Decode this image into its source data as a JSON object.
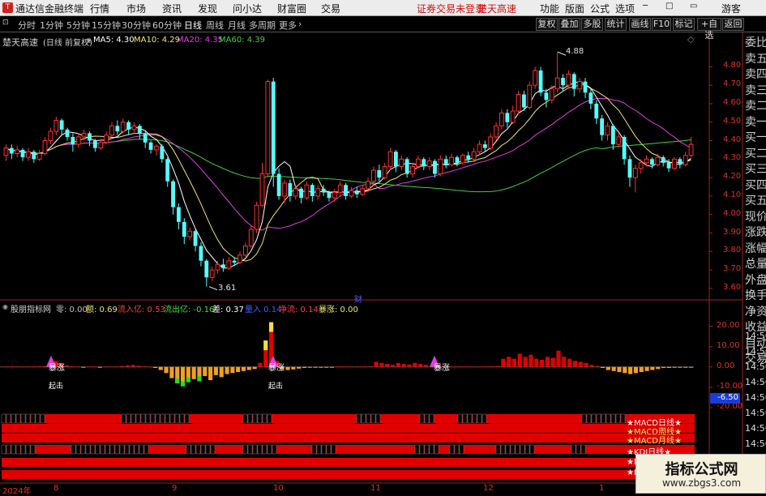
{
  "app": {
    "title": "通达信金融终端",
    "menu": [
      "行情",
      "市场",
      "资讯",
      "发现",
      "问小达",
      "财富圈",
      "交易"
    ],
    "notice1": "证券交易未登录",
    "notice2": "楚天高速",
    "right_menu": [
      "功能",
      "版面",
      "公式",
      "选项"
    ],
    "guest": "游客"
  },
  "toolbar": {
    "periods": [
      "分时",
      "1分钟",
      "5分钟",
      "15分钟",
      "30分钟",
      "60分钟",
      "日线",
      "周线",
      "月线",
      "多周期",
      "更多"
    ],
    "selected": "日线",
    "right_buttons": [
      "复权",
      "叠加",
      "多股",
      "统计",
      "画线",
      "F10",
      "标记",
      "+自选",
      "返回"
    ]
  },
  "main_panel": {
    "stock": "楚天高速",
    "mode": "(日线 前复权)",
    "ma": [
      {
        "label": "MA5: 4.30",
        "color": "#ffffff"
      },
      {
        "label": "MA10: 4.29",
        "color": "#f0e86c"
      },
      {
        "label": "MA20: 4.35",
        "color": "#e040e0"
      },
      {
        "label": "MA60: 4.39",
        "color": "#40d040"
      }
    ],
    "y_ticks": [
      "4.80",
      "4.70",
      "4.60",
      "4.50",
      "4.40",
      "4.30",
      "4.20",
      "4.10",
      "4.00",
      "3.90",
      "3.80",
      "3.70",
      "3.60"
    ],
    "high_label": "4.88",
    "low_label": "3.61",
    "cai_label": "财"
  },
  "indicator_panel": {
    "name": "股朋指标网",
    "values": [
      {
        "label": "零: 0.00",
        "color": "#c0c0c0"
      },
      {
        "label": "额: 0.69",
        "color": "#f0e86c"
      },
      {
        "label": "流入亿: 0.53",
        "color": "#ff4040"
      },
      {
        "label": "流出亿: -0.16",
        "color": "#40e040"
      },
      {
        "label": "差: 0.37",
        "color": "#ffffff"
      },
      {
        "label": "量入 0.14",
        "color": "#4060ff"
      },
      {
        "label": "净流: 0.14",
        "color": "#ff4040"
      },
      {
        "label": "暴涨: 0.00",
        "color": "#f0e86c"
      }
    ],
    "y_ticks": [
      "20.00",
      "10.00",
      "0.00",
      "-10.00",
      "-20.00"
    ],
    "current_value": "-6.50",
    "signal_baozhang": "暴涨",
    "signal_jichu": "起击",
    "band_labels": [
      "★MACD日线★",
      "★MACD周线★",
      "★MACD月线★",
      "★KDJ日线★",
      "★K"
    ]
  },
  "right_panel": {
    "items": [
      "委比",
      "卖五",
      "卖四",
      "卖三",
      "卖二",
      "卖一",
      "买一",
      "买二",
      "买三",
      "买四",
      "买五",
      "现价",
      "涨跌",
      "涨幅",
      "总量",
      "外盘",
      "换手",
      "净资",
      "收益",
      "自动",
      "交易"
    ],
    "times": [
      "14:56",
      "14:56",
      "14:56",
      "14:56",
      "14:56",
      "14:56",
      "14:56",
      "14:56",
      "14:56"
    ]
  },
  "x_axis": {
    "labels": [
      "2024年",
      "8",
      "9",
      "10",
      "11",
      "12",
      "1"
    ]
  },
  "watermark": {
    "title": "指标公式网",
    "url": "www.zbgs3.com"
  },
  "colors": {
    "up": "#ff3030",
    "down": "#54ffff",
    "ma5": "#ffffff",
    "ma10": "#f0e86c",
    "ma20": "#e040e0",
    "ma60": "#40d040",
    "bar_red": "#e00000",
    "bar_orange": "#f0a020",
    "bar_green": "#20e020",
    "band_red": "#e00000"
  },
  "chart_data": {
    "type": "candlestick",
    "price_range": [
      3.56,
      4.92
    ],
    "candles": [
      {
        "o": 4.32,
        "c": 4.36,
        "h": 4.38,
        "l": 4.29
      },
      {
        "o": 4.36,
        "c": 4.33,
        "h": 4.38,
        "l": 4.3
      },
      {
        "o": 4.33,
        "c": 4.35,
        "h": 4.37,
        "l": 4.31
      },
      {
        "o": 4.35,
        "c": 4.31,
        "h": 4.36,
        "l": 4.29
      },
      {
        "o": 4.31,
        "c": 4.34,
        "h": 4.36,
        "l": 4.29
      },
      {
        "o": 4.34,
        "c": 4.3,
        "h": 4.35,
        "l": 4.28
      },
      {
        "o": 4.3,
        "c": 4.33,
        "h": 4.35,
        "l": 4.29
      },
      {
        "o": 4.33,
        "c": 4.4,
        "h": 4.42,
        "l": 4.32
      },
      {
        "o": 4.4,
        "c": 4.45,
        "h": 4.47,
        "l": 4.38
      },
      {
        "o": 4.45,
        "c": 4.51,
        "h": 4.53,
        "l": 4.43
      },
      {
        "o": 4.51,
        "c": 4.46,
        "h": 4.52,
        "l": 4.43
      },
      {
        "o": 4.46,
        "c": 4.42,
        "h": 4.47,
        "l": 4.4
      },
      {
        "o": 4.42,
        "c": 4.38,
        "h": 4.44,
        "l": 4.34
      },
      {
        "o": 4.38,
        "c": 4.42,
        "h": 4.44,
        "l": 4.36
      },
      {
        "o": 4.42,
        "c": 4.44,
        "h": 4.46,
        "l": 4.4
      },
      {
        "o": 4.44,
        "c": 4.4,
        "h": 4.45,
        "l": 4.37
      },
      {
        "o": 4.4,
        "c": 4.36,
        "h": 4.41,
        "l": 4.34
      },
      {
        "o": 4.36,
        "c": 4.39,
        "h": 4.41,
        "l": 4.35
      },
      {
        "o": 4.39,
        "c": 4.43,
        "h": 4.45,
        "l": 4.38
      },
      {
        "o": 4.43,
        "c": 4.48,
        "h": 4.5,
        "l": 4.42
      },
      {
        "o": 4.48,
        "c": 4.45,
        "h": 4.51,
        "l": 4.43
      },
      {
        "o": 4.45,
        "c": 4.5,
        "h": 4.52,
        "l": 4.44
      },
      {
        "o": 4.5,
        "c": 4.46,
        "h": 4.51,
        "l": 4.43
      },
      {
        "o": 4.46,
        "c": 4.48,
        "h": 4.5,
        "l": 4.44
      },
      {
        "o": 4.48,
        "c": 4.44,
        "h": 4.49,
        "l": 4.41
      },
      {
        "o": 4.44,
        "c": 4.39,
        "h": 4.45,
        "l": 4.36
      },
      {
        "o": 4.39,
        "c": 4.35,
        "h": 4.4,
        "l": 4.33
      },
      {
        "o": 4.35,
        "c": 4.37,
        "h": 4.38,
        "l": 4.32
      },
      {
        "o": 4.37,
        "c": 4.3,
        "h": 4.38,
        "l": 4.28
      },
      {
        "o": 4.3,
        "c": 4.18,
        "h": 4.31,
        "l": 4.15
      },
      {
        "o": 4.18,
        "c": 4.04,
        "h": 4.19,
        "l": 4.0
      },
      {
        "o": 4.04,
        "c": 3.96,
        "h": 4.06,
        "l": 3.92
      },
      {
        "o": 3.96,
        "c": 3.88,
        "h": 3.98,
        "l": 3.84
      },
      {
        "o": 3.88,
        "c": 3.91,
        "h": 3.93,
        "l": 3.86
      },
      {
        "o": 3.91,
        "c": 3.83,
        "h": 3.92,
        "l": 3.8
      },
      {
        "o": 3.83,
        "c": 3.75,
        "h": 3.85,
        "l": 3.72
      },
      {
        "o": 3.75,
        "c": 3.66,
        "h": 3.76,
        "l": 3.61
      },
      {
        "o": 3.66,
        "c": 3.7,
        "h": 3.72,
        "l": 3.64
      },
      {
        "o": 3.7,
        "c": 3.73,
        "h": 3.75,
        "l": 3.68
      },
      {
        "o": 3.73,
        "c": 3.71,
        "h": 3.76,
        "l": 3.69
      },
      {
        "o": 3.71,
        "c": 3.75,
        "h": 3.77,
        "l": 3.7
      },
      {
        "o": 3.75,
        "c": 3.74,
        "h": 3.77,
        "l": 3.72
      },
      {
        "o": 3.74,
        "c": 3.78,
        "h": 3.8,
        "l": 3.73
      },
      {
        "o": 3.78,
        "c": 3.83,
        "h": 3.85,
        "l": 3.77
      },
      {
        "o": 3.83,
        "c": 3.92,
        "h": 3.94,
        "l": 3.82
      },
      {
        "o": 3.92,
        "c": 4.05,
        "h": 4.07,
        "l": 3.9
      },
      {
        "o": 4.05,
        "c": 4.22,
        "h": 4.28,
        "l": 4.04
      },
      {
        "o": 4.22,
        "c": 4.72,
        "h": 4.73,
        "l": 4.2
      },
      {
        "o": 4.72,
        "c": 4.22,
        "h": 4.74,
        "l": 4.15
      },
      {
        "o": 4.22,
        "c": 4.1,
        "h": 4.25,
        "l": 4.08
      },
      {
        "o": 4.1,
        "c": 4.17,
        "h": 4.19,
        "l": 4.06
      },
      {
        "o": 4.17,
        "c": 4.1,
        "h": 4.19,
        "l": 4.07
      },
      {
        "o": 4.1,
        "c": 4.14,
        "h": 4.16,
        "l": 4.08
      },
      {
        "o": 4.14,
        "c": 4.09,
        "h": 4.15,
        "l": 4.06
      },
      {
        "o": 4.09,
        "c": 4.16,
        "h": 4.18,
        "l": 4.08
      },
      {
        "o": 4.16,
        "c": 4.1,
        "h": 4.17,
        "l": 4.07
      },
      {
        "o": 4.1,
        "c": 4.14,
        "h": 4.16,
        "l": 4.08
      },
      {
        "o": 4.14,
        "c": 4.12,
        "h": 4.16,
        "l": 4.1
      },
      {
        "o": 4.12,
        "c": 4.09,
        "h": 4.13,
        "l": 4.07
      },
      {
        "o": 4.09,
        "c": 4.12,
        "h": 4.14,
        "l": 4.07
      },
      {
        "o": 4.12,
        "c": 4.16,
        "h": 4.18,
        "l": 4.1
      },
      {
        "o": 4.16,
        "c": 4.1,
        "h": 4.17,
        "l": 4.08
      },
      {
        "o": 4.1,
        "c": 4.13,
        "h": 4.15,
        "l": 4.09
      },
      {
        "o": 4.13,
        "c": 4.11,
        "h": 4.15,
        "l": 4.09
      },
      {
        "o": 4.11,
        "c": 4.14,
        "h": 4.16,
        "l": 4.1
      },
      {
        "o": 4.14,
        "c": 4.18,
        "h": 4.2,
        "l": 4.12
      },
      {
        "o": 4.18,
        "c": 4.24,
        "h": 4.26,
        "l": 4.16
      },
      {
        "o": 4.24,
        "c": 4.2,
        "h": 4.27,
        "l": 4.18
      },
      {
        "o": 4.2,
        "c": 4.26,
        "h": 4.28,
        "l": 4.19
      },
      {
        "o": 4.26,
        "c": 4.34,
        "h": 4.36,
        "l": 4.24
      },
      {
        "o": 4.34,
        "c": 4.26,
        "h": 4.35,
        "l": 4.23
      },
      {
        "o": 4.26,
        "c": 4.3,
        "h": 4.32,
        "l": 4.24
      },
      {
        "o": 4.3,
        "c": 4.22,
        "h": 4.31,
        "l": 4.2
      },
      {
        "o": 4.22,
        "c": 4.26,
        "h": 4.28,
        "l": 4.2
      },
      {
        "o": 4.26,
        "c": 4.3,
        "h": 4.32,
        "l": 4.25
      },
      {
        "o": 4.3,
        "c": 4.26,
        "h": 4.31,
        "l": 4.24
      },
      {
        "o": 4.26,
        "c": 4.29,
        "h": 4.31,
        "l": 4.24
      },
      {
        "o": 4.29,
        "c": 4.22,
        "h": 4.3,
        "l": 4.2
      },
      {
        "o": 4.22,
        "c": 4.3,
        "h": 4.32,
        "l": 4.21
      },
      {
        "o": 4.3,
        "c": 4.27,
        "h": 4.32,
        "l": 4.25
      },
      {
        "o": 4.27,
        "c": 4.31,
        "h": 4.33,
        "l": 4.26
      },
      {
        "o": 4.31,
        "c": 4.28,
        "h": 4.32,
        "l": 4.26
      },
      {
        "o": 4.28,
        "c": 4.32,
        "h": 4.33,
        "l": 4.27
      },
      {
        "o": 4.32,
        "c": 4.3,
        "h": 4.34,
        "l": 4.28
      },
      {
        "o": 4.3,
        "c": 4.34,
        "h": 4.36,
        "l": 4.29
      },
      {
        "o": 4.34,
        "c": 4.38,
        "h": 4.4,
        "l": 4.32
      },
      {
        "o": 4.38,
        "c": 4.36,
        "h": 4.4,
        "l": 4.34
      },
      {
        "o": 4.36,
        "c": 4.42,
        "h": 4.44,
        "l": 4.35
      },
      {
        "o": 4.42,
        "c": 4.48,
        "h": 4.5,
        "l": 4.4
      },
      {
        "o": 4.48,
        "c": 4.55,
        "h": 4.57,
        "l": 4.46
      },
      {
        "o": 4.55,
        "c": 4.5,
        "h": 4.57,
        "l": 4.47
      },
      {
        "o": 4.5,
        "c": 4.56,
        "h": 4.59,
        "l": 4.49
      },
      {
        "o": 4.56,
        "c": 4.65,
        "h": 4.67,
        "l": 4.54
      },
      {
        "o": 4.65,
        "c": 4.58,
        "h": 4.67,
        "l": 4.56
      },
      {
        "o": 4.58,
        "c": 4.7,
        "h": 4.72,
        "l": 4.57
      },
      {
        "o": 4.7,
        "c": 4.78,
        "h": 4.8,
        "l": 4.68
      },
      {
        "o": 4.78,
        "c": 4.66,
        "h": 4.8,
        "l": 4.64
      },
      {
        "o": 4.66,
        "c": 4.62,
        "h": 4.68,
        "l": 4.58
      },
      {
        "o": 4.62,
        "c": 4.68,
        "h": 4.7,
        "l": 4.6
      },
      {
        "o": 4.68,
        "c": 4.74,
        "h": 4.88,
        "l": 4.66
      },
      {
        "o": 4.74,
        "c": 4.7,
        "h": 4.76,
        "l": 4.67
      },
      {
        "o": 4.7,
        "c": 4.76,
        "h": 4.78,
        "l": 4.68
      },
      {
        "o": 4.76,
        "c": 4.68,
        "h": 4.77,
        "l": 4.64
      },
      {
        "o": 4.68,
        "c": 4.72,
        "h": 4.74,
        "l": 4.66
      },
      {
        "o": 4.72,
        "c": 4.66,
        "h": 4.74,
        "l": 4.63
      },
      {
        "o": 4.66,
        "c": 4.6,
        "h": 4.68,
        "l": 4.57
      },
      {
        "o": 4.6,
        "c": 4.52,
        "h": 4.62,
        "l": 4.49
      },
      {
        "o": 4.52,
        "c": 4.43,
        "h": 4.54,
        "l": 4.4
      },
      {
        "o": 4.43,
        "c": 4.48,
        "h": 4.5,
        "l": 4.4
      },
      {
        "o": 4.48,
        "c": 4.38,
        "h": 4.49,
        "l": 4.35
      },
      {
        "o": 4.38,
        "c": 4.42,
        "h": 4.44,
        "l": 4.36
      },
      {
        "o": 4.42,
        "c": 4.3,
        "h": 4.43,
        "l": 4.27
      },
      {
        "o": 4.3,
        "c": 4.2,
        "h": 4.32,
        "l": 4.15
      },
      {
        "o": 4.2,
        "c": 4.25,
        "h": 4.27,
        "l": 4.12
      },
      {
        "o": 4.25,
        "c": 4.28,
        "h": 4.3,
        "l": 4.22
      },
      {
        "o": 4.28,
        "c": 4.3,
        "h": 4.32,
        "l": 4.26
      },
      {
        "o": 4.3,
        "c": 4.27,
        "h": 4.31,
        "l": 4.25
      },
      {
        "o": 4.27,
        "c": 4.31,
        "h": 4.33,
        "l": 4.26
      },
      {
        "o": 4.31,
        "c": 4.28,
        "h": 4.32,
        "l": 4.26
      },
      {
        "o": 4.28,
        "c": 4.25,
        "h": 4.3,
        "l": 4.23
      },
      {
        "o": 4.25,
        "c": 4.3,
        "h": 4.31,
        "l": 4.24
      },
      {
        "o": 4.3,
        "c": 4.27,
        "h": 4.31,
        "l": 4.25
      },
      {
        "o": 4.27,
        "c": 4.32,
        "h": 4.34,
        "l": 4.26
      },
      {
        "o": 4.32,
        "c": 4.38,
        "h": 4.42,
        "l": 4.31
      }
    ],
    "indicator_bars": [
      0.2,
      0.3,
      0.2,
      0.1,
      0.2,
      0.3,
      0.4,
      0.5,
      0.6,
      3.0,
      2.0,
      0.8,
      0.4,
      0.3,
      -0.3,
      0.2,
      0.3,
      -0.4,
      0.2,
      0.1,
      0.3,
      0.5,
      0.8,
      1.0,
      0.6,
      0.4,
      0.2,
      -0.5,
      -1.5,
      -3.0,
      -5.5,
      -8.0,
      -9.5,
      -7.5,
      -6.0,
      -7.0,
      -4.5,
      -6.5,
      -4.0,
      -5.0,
      -3.5,
      -3.0,
      -2.5,
      -2.0,
      -1.5,
      -1.0,
      2.0,
      13.0,
      22.0,
      3.0,
      -1.0,
      -1.5,
      -1.2,
      -0.8,
      -0.5,
      -0.3,
      -0.2,
      -0.2,
      -0.3,
      -0.2,
      0.2,
      0.3,
      0.2,
      0.1,
      0.2,
      0.3,
      0.4,
      2.5,
      2.0,
      1.5,
      1.0,
      2.0,
      1.5,
      1.2,
      2.0,
      1.5,
      1.0,
      0.5,
      0.3,
      0.2,
      0.2,
      0.3,
      0.2,
      0.3,
      0.2,
      0.1,
      0.2,
      0.3,
      0.4,
      0.5,
      4.0,
      5.0,
      4.0,
      6.5,
      5.0,
      6.0,
      4.0,
      3.5,
      5.0,
      4.5,
      8.0,
      5.0,
      4.0,
      3.0,
      2.5,
      2.0,
      1.0,
      0.5,
      -0.5,
      -1.5,
      -2.0,
      -2.5,
      -3.0,
      -3.5,
      -3.0,
      -2.5,
      -2.0,
      -1.5,
      -1.0,
      -0.5,
      -0.5,
      -0.3,
      -0.2,
      -0.1,
      -0.2
    ]
  }
}
